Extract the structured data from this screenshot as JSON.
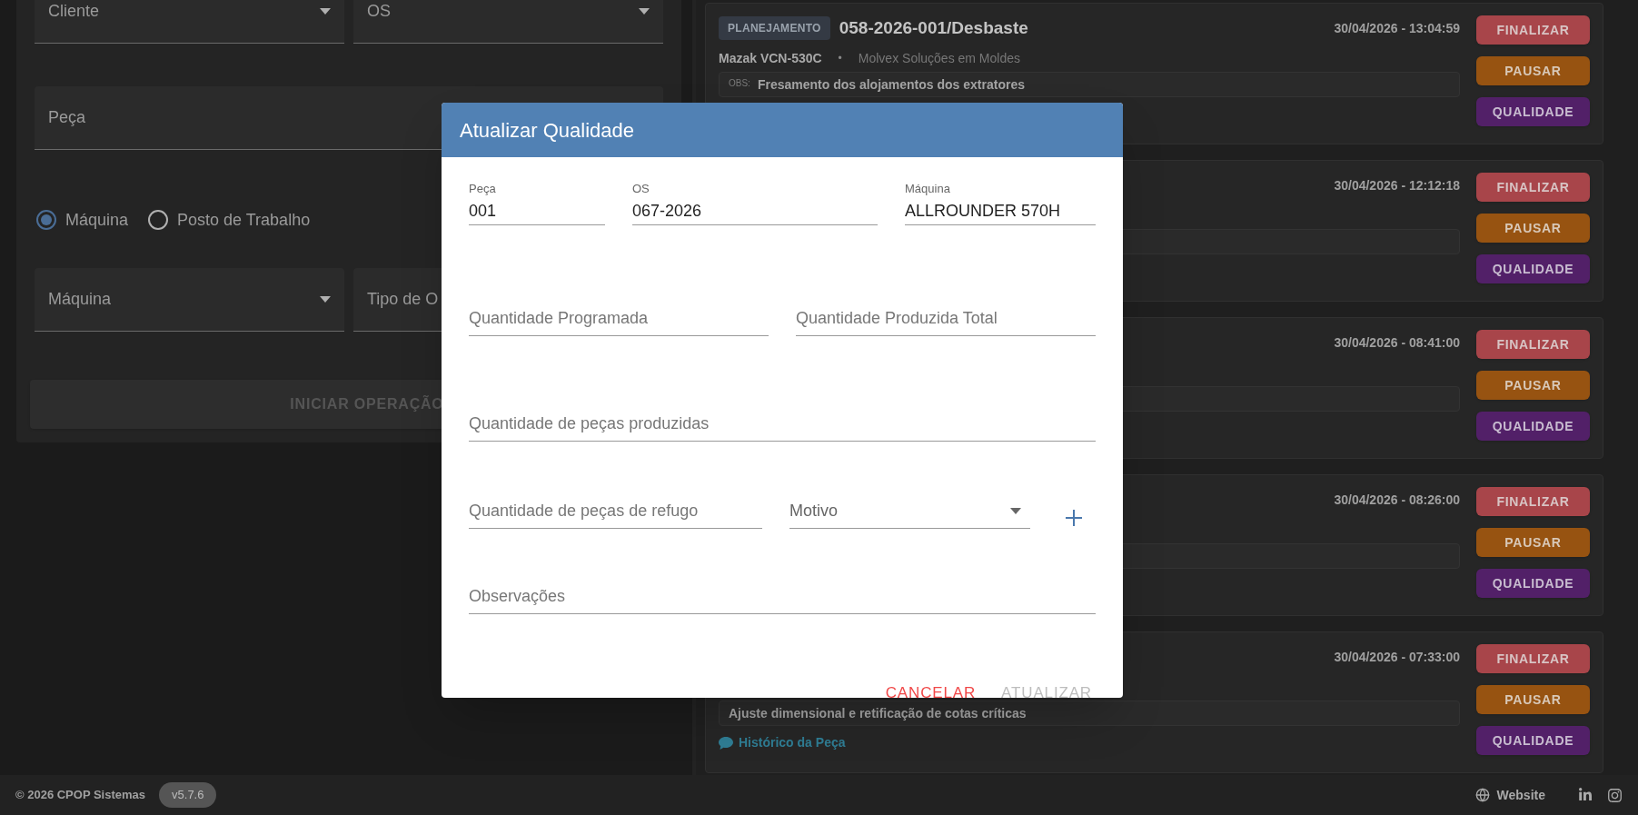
{
  "filter_form": {
    "top_fields": [
      {
        "kind": "select",
        "label": "Cliente"
      },
      {
        "kind": "select",
        "label": "OS"
      }
    ],
    "part_field": {
      "placeholder": "Peça"
    },
    "radio_options": [
      {
        "label": "Máquina",
        "selected": true
      },
      {
        "label": "Posto de Trabalho",
        "selected": false
      }
    ],
    "bottom_fields": [
      {
        "kind": "select",
        "label": "Máquina"
      },
      {
        "kind": "partial",
        "label": "Tipo de O"
      }
    ],
    "start_button": "INICIAR OPERAÇÃO"
  },
  "operations": [
    {
      "badge": "PLANEJAMENTO",
      "title": "058-2026-001/Desbaste",
      "machine": "Mazak VCN-530C",
      "separator": "•",
      "client": "Molvex Soluções em Moldes",
      "obs_label": "OBS:",
      "obs": "Fresamento dos alojamentos dos extratores",
      "timestamp": "30/04/2026 - 13:04:59",
      "actions": [
        {
          "kind": "finish",
          "label": "FINALIZAR"
        },
        {
          "kind": "pause",
          "label": "PAUSAR"
        },
        {
          "kind": "quality",
          "label": "QUALIDADE"
        }
      ]
    },
    {
      "timestamp": "30/04/2026 - 12:12:18",
      "actions": [
        {
          "kind": "finish",
          "label": "FINALIZAR"
        },
        {
          "kind": "pause",
          "label": "PAUSAR"
        },
        {
          "kind": "quality",
          "label": "QUALIDADE"
        }
      ]
    },
    {
      "timestamp": "30/04/2026 - 08:41:00",
      "actions": [
        {
          "kind": "finish",
          "label": "FINALIZAR"
        },
        {
          "kind": "pause",
          "label": "PAUSAR"
        },
        {
          "kind": "quality",
          "label": "QUALIDADE"
        }
      ]
    },
    {
      "timestamp": "30/04/2026 - 08:26:00",
      "actions": [
        {
          "kind": "finish",
          "label": "FINALIZAR"
        },
        {
          "kind": "pause",
          "label": "PAUSAR"
        },
        {
          "kind": "quality",
          "label": "QUALIDADE"
        }
      ]
    },
    {
      "timestamp": "30/04/2026 - 07:33:00",
      "obs": "Ajuste dimensional e retificação de cotas críticas",
      "history_link": "Histórico da Peça",
      "actions": [
        {
          "kind": "finish",
          "label": "FINALIZAR"
        },
        {
          "kind": "pause",
          "label": "PAUSAR"
        },
        {
          "kind": "quality",
          "label": "QUALIDADE"
        }
      ]
    }
  ],
  "dialog": {
    "title": "Atualizar Qualidade",
    "info_fields": [
      {
        "label": "Peça",
        "value": "001"
      },
      {
        "label": "OS",
        "value": "067-2026"
      },
      {
        "label": "Máquina",
        "value": "ALLROUNDER 570H"
      }
    ],
    "quantity_fields": [
      {
        "placeholder": "Quantidade Programada"
      },
      {
        "placeholder": "Quantidade Produzida Total"
      }
    ],
    "produced_field": {
      "placeholder": "Quantidade de peças produzidas"
    },
    "scrap_field": {
      "placeholder": "Quantidade de peças de refugo"
    },
    "reason_select": {
      "label": "Motivo"
    },
    "notes_field": {
      "placeholder": "Observações"
    },
    "buttons": [
      {
        "kind": "cancel",
        "label": "CANCELAR"
      },
      {
        "kind": "submit",
        "label": "ATUALIZAR",
        "disabled": true
      }
    ]
  },
  "footer": {
    "copyright": "© 2026 CPOP Sistemas",
    "version": "v5.7.6",
    "website_link": "Website"
  }
}
